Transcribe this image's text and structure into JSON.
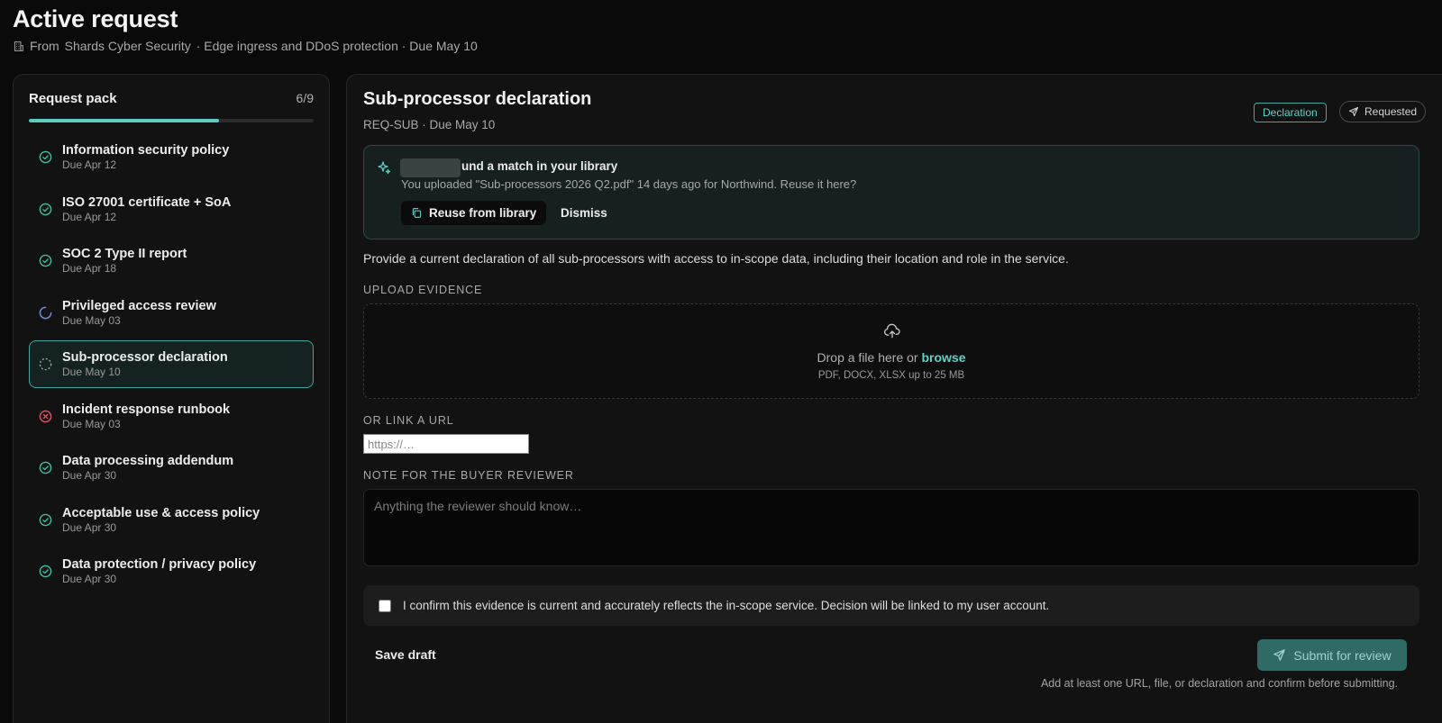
{
  "header": {
    "title": "Active request",
    "from_label": "From",
    "vendor": "Shards Cyber Security",
    "scope": "· Edge ingress and DDoS protection · Due May 10"
  },
  "sidebar": {
    "title": "Request pack",
    "count": "6/9",
    "progress_fraction": 0.667,
    "items": [
      {
        "label": "Information security policy",
        "due": "Due Apr 12",
        "status": "done"
      },
      {
        "label": "ISO 27001 certificate + SoA",
        "due": "Due Apr 12",
        "status": "done"
      },
      {
        "label": "SOC 2 Type II report",
        "due": "Due Apr 18",
        "status": "done"
      },
      {
        "label": "Privileged access review",
        "due": "Due May 03",
        "status": "in-progress"
      },
      {
        "label": "Sub-processor declaration",
        "due": "Due May 10",
        "status": "pending"
      },
      {
        "label": "Incident response runbook",
        "due": "Due May 03",
        "status": "rejected"
      },
      {
        "label": "Data processing addendum",
        "due": "Due Apr 30",
        "status": "done"
      },
      {
        "label": "Acceptable use & access policy",
        "due": "Due Apr 30",
        "status": "done"
      },
      {
        "label": "Data protection / privacy policy",
        "due": "Due Apr 30",
        "status": "done"
      }
    ]
  },
  "main": {
    "title": "Sub-processor declaration",
    "subtitle": "REQ-SUB · Due May 10",
    "badge_type": "Declaration",
    "badge_status": "Requested",
    "match": {
      "title": "und a match in your library",
      "description": "You uploaded \"Sub-processors 2026 Q2.pdf\" 14 days ago for Northwind. Reuse it here?",
      "reuse_label": "Reuse from library",
      "dismiss_label": "Dismiss"
    },
    "instructions": "Provide a current declaration of all sub-processors with access to in-scope data, including their location and role in the service.",
    "upload": {
      "label": "UPLOAD EVIDENCE",
      "drop_text": "Drop a file here or",
      "browse_label": "browse",
      "hint": "PDF, DOCX, XLSX up to 25 MB"
    },
    "url": {
      "label": "OR LINK A URL",
      "placeholder": "https://…"
    },
    "note": {
      "label": "NOTE FOR THE BUYER REVIEWER",
      "placeholder": "Anything the reviewer should know…"
    },
    "confirm_text": "I confirm this evidence is current and accurately reflects the in-scope service. Decision will be linked to my user account.",
    "save_draft_label": "Save draft",
    "submit_label": "Submit for review",
    "helper_text": "Add at least one URL, file, or declaration and confirm before submitting."
  },
  "colors": {
    "accent": "#5ec9c0",
    "done": "#3fbf9f",
    "in_progress": "#6f8fd8",
    "rejected": "#d9545f",
    "pending": "#a0a0a0"
  }
}
